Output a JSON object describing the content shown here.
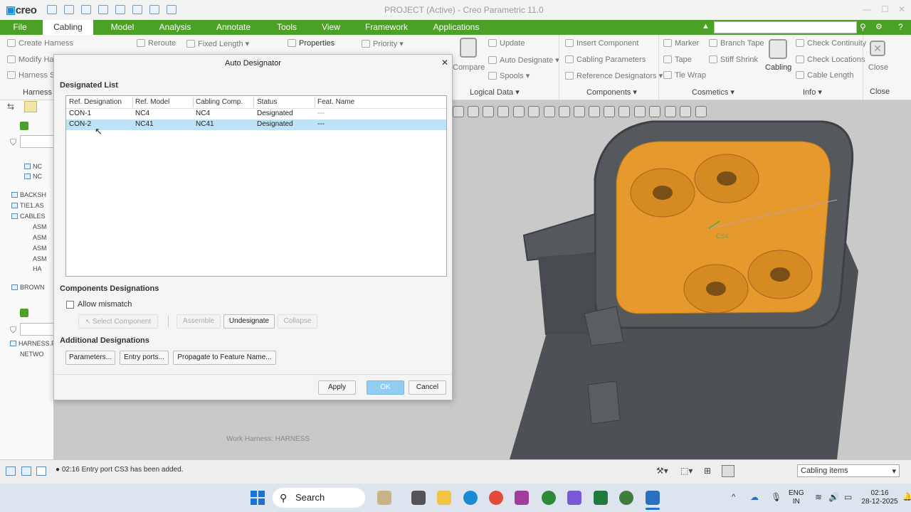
{
  "app": {
    "logo": "creo",
    "window_title": "PROJECT (Active) - Creo Parametric 11.0"
  },
  "tabs": [
    "File",
    "Cabling",
    "Model",
    "Analysis",
    "Annotate",
    "Tools",
    "View",
    "Framework",
    "Applications"
  ],
  "active_tab": "Cabling",
  "ribbon": {
    "col1": [
      "Create Harness",
      "Modify Har",
      "Harness Set"
    ],
    "reroute": "Reroute",
    "fixed_length": "Fixed Length",
    "properties": "Properties",
    "priority": "Priority",
    "compare": "Compare",
    "logical": [
      "Update",
      "Auto Designate",
      "Spools"
    ],
    "components": [
      "Insert Component",
      "Cabling Parameters",
      "Reference Designators"
    ],
    "cosmetics_a": [
      "Marker",
      "Tape",
      "Tie Wrap"
    ],
    "cosmetics_b": [
      "Branch Tape",
      "Stiff Shrink"
    ],
    "cabling_btn": "Cabling",
    "info": [
      "Check Continuity",
      "Check Locations",
      "Cable Length"
    ],
    "close": "Close",
    "groups": {
      "harness": "Harness",
      "logical_data": "Logical Data",
      "components": "Components",
      "cosmetics": "Cosmetics",
      "info": "Info",
      "close": "Close"
    }
  },
  "tree": {
    "items": [
      "NC",
      "NC",
      "BACKSH",
      "TIE1.AS",
      "CABLES",
      "ASM",
      "ASM",
      "ASM",
      "ASM",
      "HA",
      "BROWN"
    ],
    "items2": [
      "HARNESS.PR",
      "NETWO"
    ]
  },
  "viewport": {
    "work_harness": "Work Harness: HARNESS",
    "cs_label": "CS4"
  },
  "dialog": {
    "title": "Auto Designator",
    "designated_list_label": "Designated List",
    "columns": [
      "Ref. Designation",
      "Ref. Model",
      "Cabling Comp.",
      "Status",
      "Feat. Name"
    ],
    "rows": [
      {
        "ref": "CON-1",
        "model": "NC4",
        "comp": "NC4",
        "status": "Designated",
        "feat": "---"
      },
      {
        "ref": "CON-2",
        "model": "NC41",
        "comp": "NC41",
        "status": "Designated",
        "feat": "---"
      }
    ],
    "components_designations_label": "Components Designations",
    "allow_mismatch": "Allow mismatch",
    "select_component": "Select Component",
    "assemble": "Assemble",
    "undesignate": "Undesignate",
    "collapse": "Collapse",
    "additional_designations_label": "Additional Designations",
    "parameters": "Parameters...",
    "entry_ports": "Entry ports...",
    "propagate": "Propagate to Feature Name...",
    "apply": "Apply",
    "ok": "OK",
    "cancel": "Cancel"
  },
  "status": {
    "message": "02:16 Entry port CS3 has been added.",
    "filter": "Cabling items"
  },
  "taskbar": {
    "search": "Search",
    "lang_1": "ENG",
    "lang_2": "IN",
    "time": "02:16",
    "date": "28-12-2025"
  },
  "colors": {
    "tab_green": "#4ba026",
    "connector_orange": "#e69a2e",
    "selection_blue": "#bfe3f6",
    "ok_blue": "#90cdf0"
  }
}
